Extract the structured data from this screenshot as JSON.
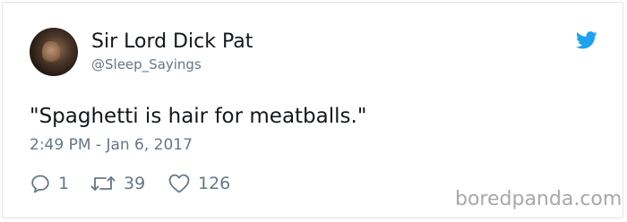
{
  "tweet": {
    "author_name": "Sir Lord Dick Pat",
    "handle": "@Sleep_Sayings",
    "text": "\"Spaghetti is hair for meatballs.\"",
    "timestamp": "2:49 PM - Jan 6, 2017",
    "replies": "1",
    "retweets": "39",
    "likes": "126"
  },
  "icons": {
    "brand": "twitter-bird-icon",
    "reply": "reply-icon",
    "retweet": "retweet-icon",
    "like": "heart-icon"
  },
  "colors": {
    "brand_blue": "#1da1f2",
    "secondary_text": "#657786",
    "primary_text": "#14171a",
    "watermark": "#a8a8a8"
  },
  "watermark": "boredpanda.com"
}
